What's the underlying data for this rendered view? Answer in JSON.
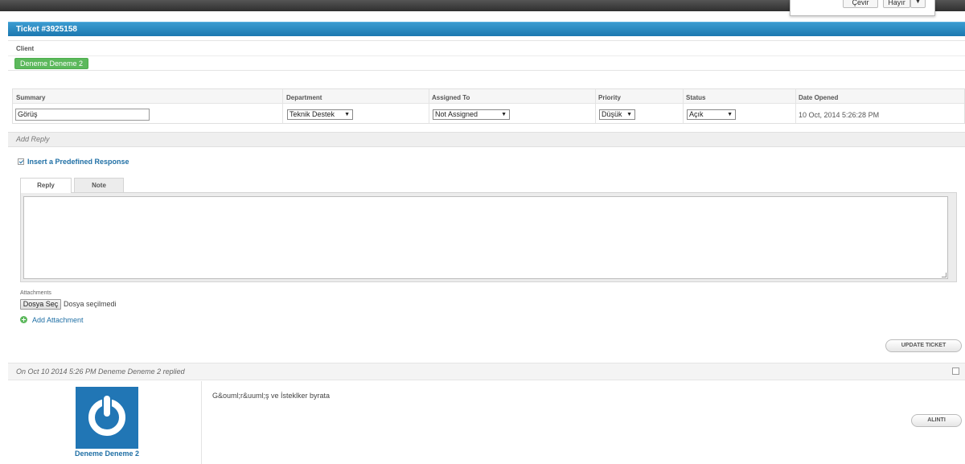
{
  "translate_popup": {
    "translate_label": "Çevir",
    "no_label": "Hayır",
    "menu_arrow": "▼"
  },
  "ticket": {
    "title": "Ticket #3925158"
  },
  "client": {
    "label": "Client",
    "name": "Deneme Deneme 2"
  },
  "info": {
    "headers": [
      "Summary",
      "Department",
      "Assigned To",
      "Priority",
      "Status",
      "Date Opened"
    ],
    "summary_value": "Görüş",
    "department": "Teknik Destek",
    "assigned_to": "Not Assigned",
    "priority": "Düşük",
    "status": "Açık",
    "date_opened": "10 Oct, 2014 5:26:28 PM",
    "select_arrow": "▼"
  },
  "add_reply": {
    "label": "Add Reply"
  },
  "predefined": {
    "label": "Insert a Predefined Response"
  },
  "tabs": [
    {
      "label": "Reply",
      "active": true
    },
    {
      "label": "Note",
      "active": false
    }
  ],
  "attachments": {
    "label": "Attachments",
    "choose_file": "Dosya Seç",
    "no_file": "Dosya seçilmedi",
    "add_label": "Add Attachment"
  },
  "update_button": "UPDATE TICKET",
  "reply": {
    "header": "On Oct 10 2014 5:26 PM Deneme Deneme 2 replied",
    "author": "Deneme Deneme 2",
    "message": "G&ouml;r&uuml;ş ve İsteklker byrata",
    "quote_button": "ALINTI"
  },
  "colors": {
    "header_blue": "#1c78b0",
    "client_green": "#5cb85c",
    "link_blue": "#1f6fa5",
    "avatar_blue": "#2176b5"
  }
}
